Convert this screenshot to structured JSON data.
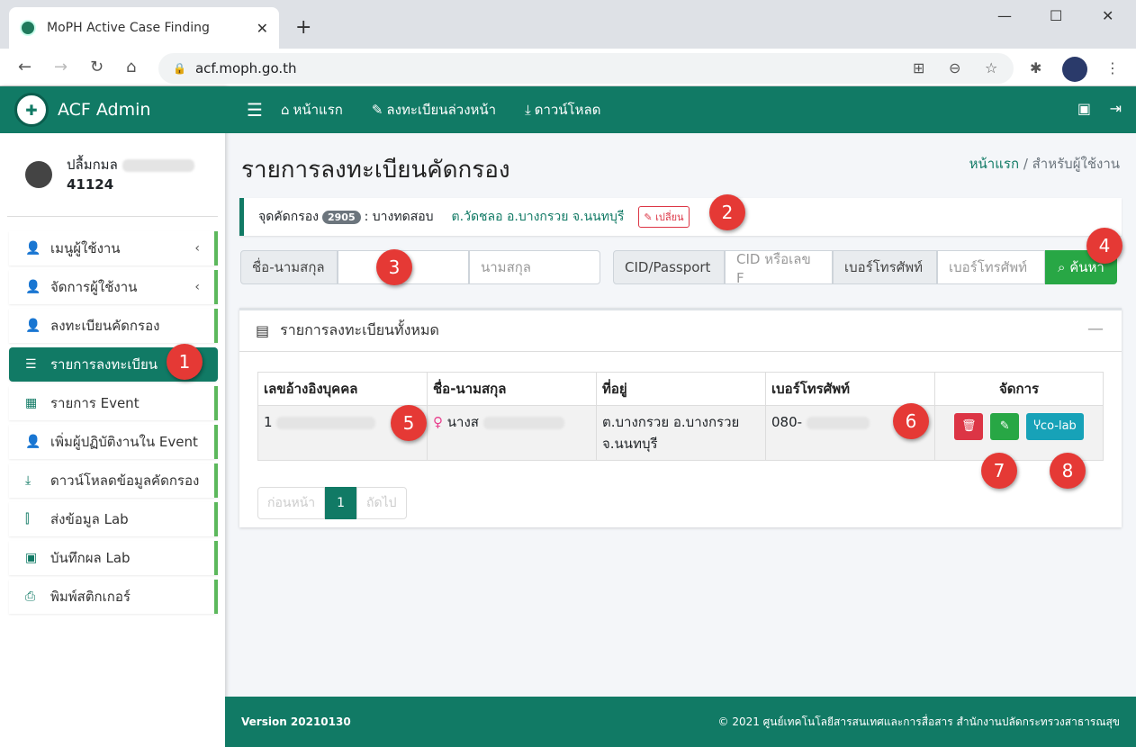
{
  "browser": {
    "tab_title": "MoPH Active Case Finding",
    "url": "acf.moph.go.th"
  },
  "brand": {
    "title": "ACF Admin"
  },
  "user": {
    "name": "ปลื้มกมล",
    "id": "41124"
  },
  "sidebar": {
    "items": [
      {
        "label": "เมนูผู้ใช้งาน"
      },
      {
        "label": "จัดการผู้ใช้งาน"
      },
      {
        "label": "ลงทะเบียนคัดกรอง"
      },
      {
        "label": "รายการลงทะเบียน"
      },
      {
        "label": "รายการ Event"
      },
      {
        "label": "เพิ่มผู้ปฏิบัติงานใน Event"
      },
      {
        "label": "ดาวน์โหลดข้อมูลคัดกรอง"
      },
      {
        "label": "ส่งข้อมูล Lab"
      },
      {
        "label": "บันทึกผล Lab"
      },
      {
        "label": "พิมพ์สติกเกอร์"
      }
    ]
  },
  "topnav": {
    "home": "หน้าแรก",
    "preregister": "ลงทะเบียนล่วงหน้า",
    "download": "ดาวน์โหลด"
  },
  "page": {
    "title": "รายการลงทะเบียนคัดกรอง",
    "breadcrumb_home": "หน้าแรก",
    "breadcrumb_sep": "/",
    "breadcrumb_current": "สำหรับผู้ใช้งาน"
  },
  "site": {
    "label": "จุดคัดกรอง",
    "code": "2905",
    "name": ": บางทดสอบ",
    "location": "ต.วัดชลอ อ.บางกรวย จ.นนทบุรี",
    "change_label": "เปลี่ยน"
  },
  "search": {
    "name_label": "ชื่อ-นามสกุล",
    "firstname_value": "",
    "lastname_placeholder": "นามสกุล",
    "cid_label": "CID/Passport",
    "cid_placeholder": "CID หรือเลข F",
    "phone_label": "เบอร์โทรศัพท์",
    "phone_placeholder": "เบอร์โทรศัพท์",
    "button_label": "ค้นหา"
  },
  "list": {
    "title": "รายการลงทะเบียนทั้งหมด",
    "columns": [
      "เลขอ้างอิงบุคคล",
      "ชื่อ-นามสกุล",
      "ที่อยู่",
      "เบอร์โทรศัพท์",
      "จัดการ"
    ],
    "rows": [
      {
        "ref": "1",
        "name": "นางส",
        "address": "ต.บางกรวย อ.บางกรวย จ.นนทบุรี",
        "phone": "080-"
      }
    ],
    "colab_label": "co-lab"
  },
  "pagination": {
    "prev": "ก่อนหน้า",
    "page": "1",
    "next": "ถัดไป"
  },
  "footer": {
    "version": "Version 20210130",
    "copyright": "© 2021 ศูนย์เทคโนโลยีสารสนเทศและการสื่อสาร สำนักงานปลัดกระทรวงสาธารณสุข"
  },
  "markers": [
    "1",
    "2",
    "3",
    "4",
    "5",
    "6",
    "7",
    "8"
  ],
  "colors": {
    "primary": "#117a65",
    "danger": "#dc3545",
    "success": "#28a745",
    "info": "#17a2b8",
    "marker": "#e53935"
  }
}
